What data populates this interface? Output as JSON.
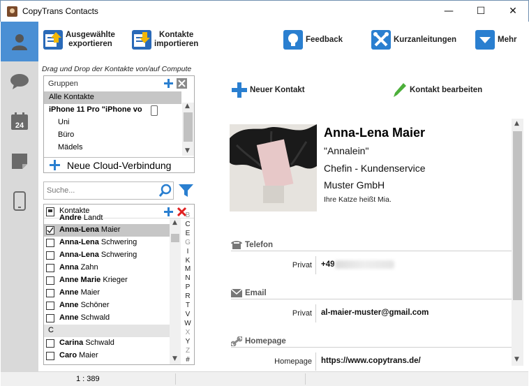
{
  "window": {
    "title": "CopyTrans Contacts",
    "minimize": "—",
    "maximize": "☐",
    "close": "✕"
  },
  "toolbar": {
    "export": "Ausgewählte\nexportieren",
    "import": "Kontakte\nimportieren",
    "feedback": "Feedback",
    "guides": "Kurzanleitungen",
    "more": "Mehr"
  },
  "left": {
    "drag_hint": "Drag und Drop der Kontakte von/auf Compute",
    "groups_label": "Gruppen",
    "groups": [
      "Alle Kontakte",
      "iPhone 11 Pro \"iPhone vo",
      "Uni",
      "Büro",
      "Mädels"
    ],
    "cloud": "Neue Cloud-Verbindung",
    "search_placeholder": "Suche...",
    "contacts_label": "Kontakte",
    "contacts": [
      {
        "first": "Andre",
        "last": "Landt"
      },
      {
        "first": "Anna-Lena",
        "last": "Maier"
      },
      {
        "first": "Anna-Lena",
        "last": "Schwering"
      },
      {
        "first": "Anna-Lena",
        "last": "Schwering"
      },
      {
        "first": "Anna",
        "last": "Zahn"
      },
      {
        "first": "Anne Marie",
        "last": "Krieger"
      },
      {
        "first": "Anne",
        "last": "Maier"
      },
      {
        "first": "Anne",
        "last": "Schöner"
      },
      {
        "first": "Anne",
        "last": "Schwald"
      },
      {
        "letter": "C"
      },
      {
        "first": "Carina",
        "last": "Schwald"
      },
      {
        "first": "Caro",
        "last": "Maier"
      }
    ],
    "alphabet": [
      "B",
      "C",
      "E",
      "G",
      "I",
      "K",
      "M",
      "N",
      "P",
      "R",
      "T",
      "V",
      "W",
      "X",
      "Y",
      "Z",
      "#"
    ]
  },
  "right": {
    "new_contact": "Neuer Kontakt",
    "edit_contact": "Kontakt bearbeiten",
    "name": "Anna-Lena Maier",
    "nickname": "\"Annalein\"",
    "job": "Chefin - Kundenservice",
    "company": "Muster GmbH",
    "note": "Ihre Katze heißt Mia.",
    "phone_section": "Telefon",
    "phone_label": "Privat",
    "phone_value": "+49",
    "email_section": "Email",
    "email_label": "Privat",
    "email_value": "al-maier-muster@gmail.com",
    "homepage_section": "Homepage",
    "homepage_label": "Homepage",
    "homepage_value": "https://www.copytrans.de/"
  },
  "status": {
    "count": "1 : 389"
  }
}
